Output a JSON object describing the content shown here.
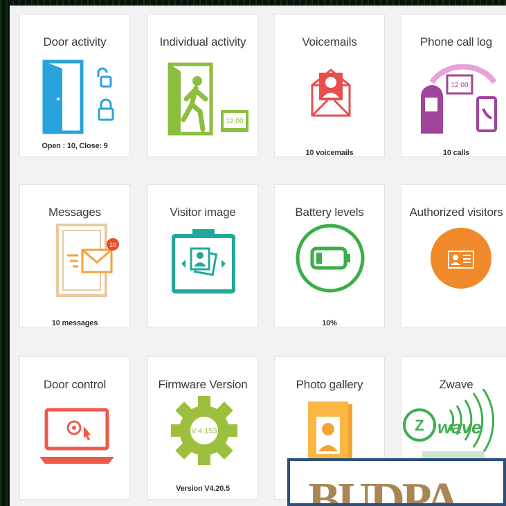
{
  "cards": [
    {
      "title": "Door activity",
      "value": "Open : 10, Close: 9",
      "icon": "door-lock-icon"
    },
    {
      "title": "Individual activity",
      "value": "",
      "icon": "person-exit-clock-icon",
      "clock_text": "12:00"
    },
    {
      "title": "Voicemails",
      "value": "10 voicemails",
      "icon": "envelope-user-icon"
    },
    {
      "title": "Phone call log",
      "value": "10 calls",
      "icon": "intercom-phone-icon",
      "clock_text": "12:00"
    },
    {
      "title": "Messages",
      "value": "10 messages",
      "icon": "door-envelope-icon",
      "badge_count": "10"
    },
    {
      "title": "Visitor image",
      "value": "",
      "icon": "camera-photos-icon"
    },
    {
      "title": "Battery levels",
      "value": "10%",
      "icon": "battery-icon"
    },
    {
      "title": "Authorized visitors",
      "value": "",
      "icon": "id-card-icon"
    },
    {
      "title": "Door control",
      "value": "",
      "icon": "laptop-unlock-icon"
    },
    {
      "title": "Firmware Version",
      "value": "Version V4.20.5",
      "icon": "gear-icon",
      "gear_text": "V.4.153"
    },
    {
      "title": "Photo gallery",
      "value": "",
      "icon": "photo-book-icon"
    },
    {
      "title": "Zwave",
      "value": "",
      "icon": "zwave-logo-icon",
      "logo_text": "wave"
    }
  ],
  "overlay": {
    "text": "BUDPA"
  },
  "colors": {
    "door_blue": "#29a3dc",
    "green": "#8bbd3e",
    "red": "#e84e4e",
    "purple": "#a0449a",
    "tan": "#e8c9a0",
    "orange_msg": "#f2a33a",
    "teal": "#21a89a",
    "battery_green": "#3aae47",
    "orange": "#f0892a",
    "laptop_red": "#ee5a4a",
    "gear_green": "#9cbf3d",
    "book_orange": "#f4a531",
    "zwave_green": "#3fae4f"
  }
}
